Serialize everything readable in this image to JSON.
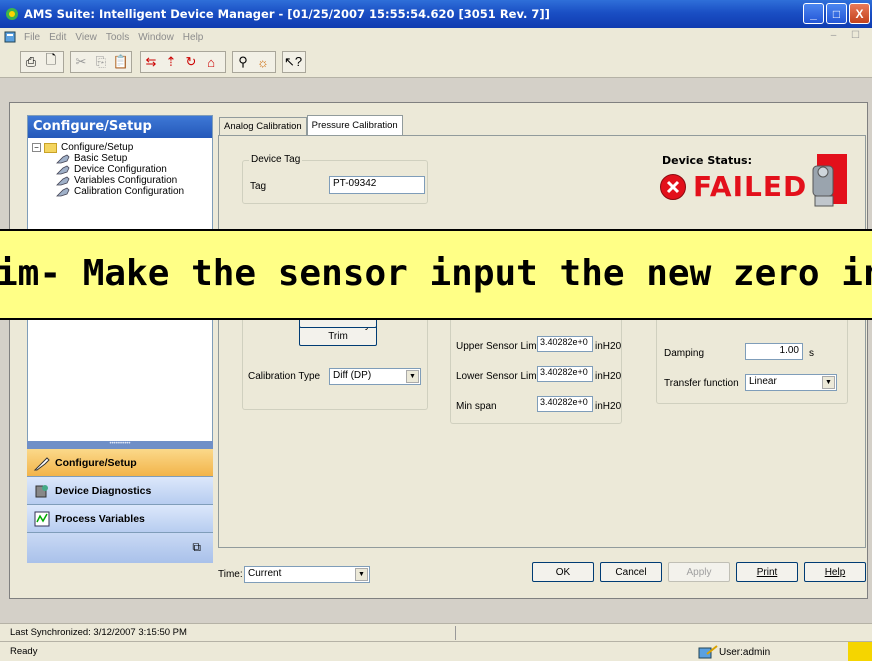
{
  "window": {
    "title": "AMS Suite: Intelligent Device Manager - [01/25/2007 15:55:54.620 [3051 Rev. 7]]",
    "min": "_",
    "max": "□",
    "close": "X"
  },
  "menu": [
    "File",
    "Edit",
    "View",
    "Tools",
    "Window",
    "Help"
  ],
  "left_panel": {
    "header": "Configure/Setup",
    "tree_root": "Configure/Setup",
    "tree_items": [
      "Basic Setup",
      "Device Configuration",
      "Variables Configuration",
      "Calibration Configuration"
    ],
    "nav_buttons": [
      "Configure/Setup",
      "Device Diagnostics",
      "Process Variables"
    ]
  },
  "tabs": [
    "Analog Calibration",
    "Pressure Calibration"
  ],
  "device_tag": {
    "group_label": "Device Tag",
    "tag_label": "Tag",
    "tag_value": "PT-09342"
  },
  "device_status": {
    "title": "Device Status:",
    "value": "FAILED"
  },
  "banner": {
    "text": "im- Make the sensor input the new zero input"
  },
  "calibration": {
    "recall_factory_trim": "Recall Factory Trim",
    "calibration_type_label": "Calibration Type",
    "calibration_type_value": "Diff (DP)"
  },
  "sensor_limits": {
    "upper_label": "Upper Sensor Limit",
    "upper_value": "3.40282e+0",
    "upper_unit": "inH20",
    "lower_label": "Lower Sensor Limit",
    "lower_value": "3.40282e+0",
    "lower_unit": "inH20",
    "min_span_label": "Min span",
    "min_span_value": "3.40282e+0",
    "min_span_unit": "inH20"
  },
  "output": {
    "damping_label": "Damping",
    "damping_value": "1.00",
    "damping_unit": "s",
    "transfer_label": "Transfer function",
    "transfer_value": "Linear"
  },
  "footer": {
    "time_label": "Time:",
    "time_value": "Current",
    "ok": "OK",
    "cancel": "Cancel",
    "apply": "Apply",
    "print": "Print",
    "help": "Help"
  },
  "status": {
    "last_sync": "Last Synchronized: 3/12/2007 3:15:50 PM",
    "ready": "Ready",
    "user": "User:admin"
  },
  "colors": {
    "failed_red": "#e3101b",
    "banner_yellow": "#ffff86",
    "nav_active": "#f2b44a"
  }
}
